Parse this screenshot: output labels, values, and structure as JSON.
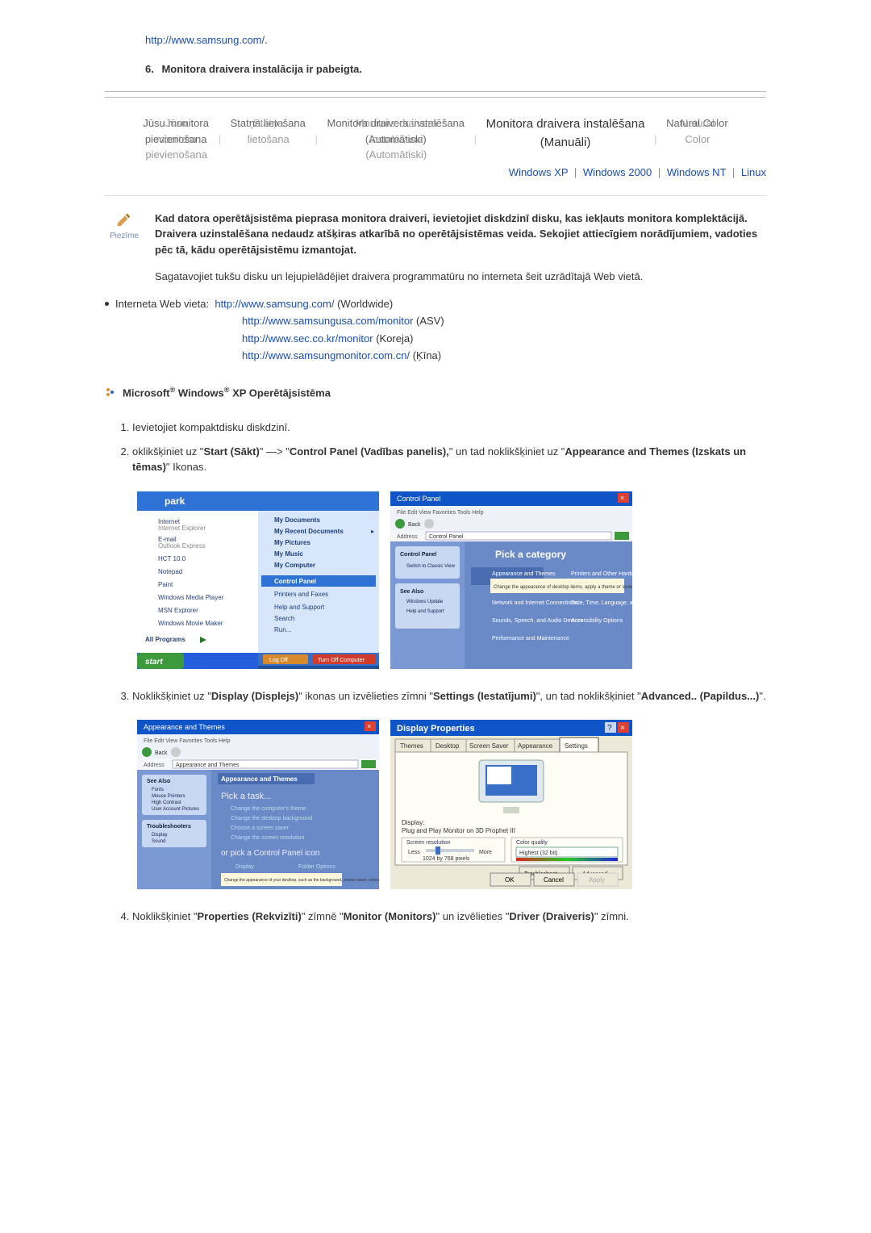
{
  "top": {
    "url": "http://www.samsung.com/",
    "dot": ".",
    "step6_num": "6.",
    "step6": "Monitora draivera instalācija ir pabeigta."
  },
  "tabs": {
    "t1a": "Jūsu monitora",
    "t1b": "pievienošana",
    "t2": "Statņa lietošana",
    "t3a": "Monitora draivera instalēšana",
    "t3b": "(Automātiski)",
    "t4a": "Monitora draivera instalēšana",
    "t4b": "(Manuāli)",
    "t5": "Natural Color"
  },
  "oslinks": {
    "xp": "Windows XP",
    "w2k": "Windows 2000",
    "nt": "Windows NT",
    "lx": "Linux"
  },
  "note": {
    "label": "Piezīme",
    "p1": "Kad datora operētājsistēma pieprasa monitora draiveri, ievietojiet diskdzinī disku, kas iekļauts monitora komplektācijā. Draivera uzinstalēšana nedaudz atšķiras atkarībā no operētājsistēmas veida. Sekojiet attiecīgiem norādījumiem, vadoties pēc tā, kādu operētājsistēmu izmantojat.",
    "p2": "Sagatavojiet tukšu disku un lejupielādējiet draivera programmatūru no interneta šeit uzrādītajā Web vietā."
  },
  "web": {
    "label": "Interneta Web vieta:",
    "u1": "http://www.samsung.com/",
    "u1p": "(Worldwide)",
    "u2": "http://www.samsungusa.com/monitor",
    "u2p": "(ASV)",
    "u3": "http://www.sec.co.kr/monitor",
    "u3p": "(Koreja)",
    "u4": "http://www.samsungmonitor.com.cn/",
    "u4p": "(Ķīna)"
  },
  "section": {
    "pre": "Microsoft",
    "reg": "®",
    "mid": " Windows",
    "reg2": "®",
    "post": " XP Operētājsistēma"
  },
  "steps": {
    "s1": "Ievietojiet kompaktdisku diskdzinī.",
    "s2a": "oklikšķiniet uz \"",
    "s2b": "Start (Sākt)",
    "s2c": "\" —> \"",
    "s2d": "Control Panel (Vadības panelis),",
    "s2e": "\" un tad noklikšķiniet uz \"",
    "s2f": "Appearance and Themes (Izskats un tēmas)",
    "s2g": "\" Ikonas.",
    "s3a": "Noklikšķiniet uz \"",
    "s3b": "Display (Displejs)",
    "s3c": "\" ikonas un izvēlieties zīmni \"",
    "s3d": "Settings (Iestatījumi)",
    "s3e": "\", un tad noklikšķiniet \"",
    "s3f": "Advanced.. (Papildus...)",
    "s3g": "\".",
    "s4a": "Noklikšķiniet \"",
    "s4b": "Properties (Rekvizīti)",
    "s4c": "\" zīmnē \"",
    "s4d": "Monitor (Monitors)",
    "s4e": "\" un izvēlieties \"",
    "s4f": "Driver (Draiveris)",
    "s4g": "\" zīmni."
  }
}
